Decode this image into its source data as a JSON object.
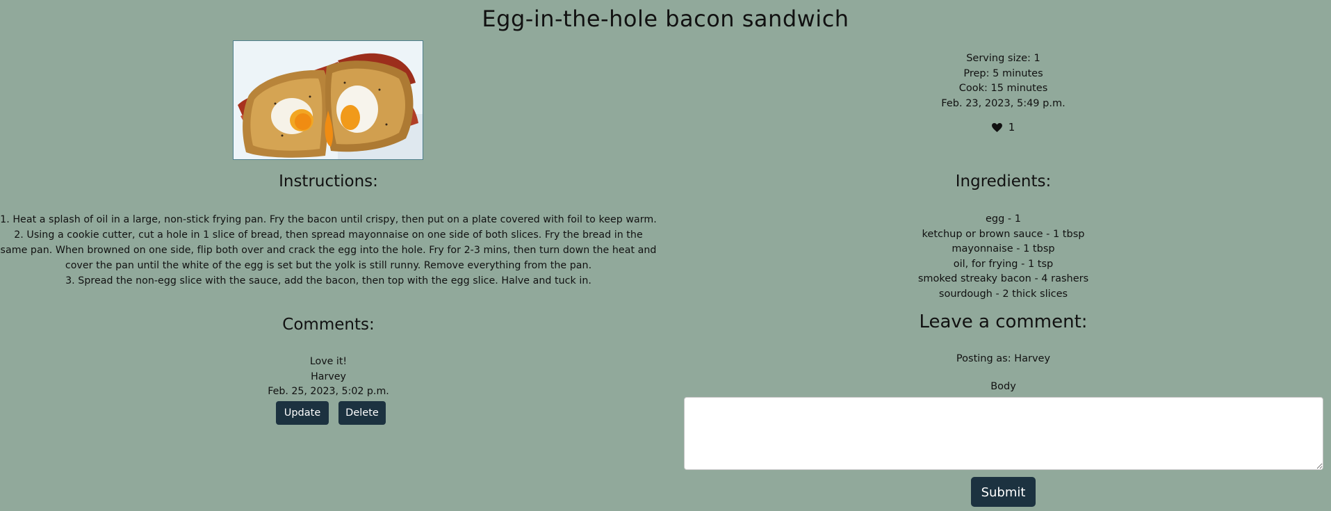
{
  "recipe": {
    "title": "Egg-in-the-hole bacon sandwich",
    "image_alt": "egg-in-the-hole bacon sandwich photo"
  },
  "meta": {
    "serving": "Serving size: 1",
    "prep": "Prep: 5 minutes",
    "cook": "Cook: 15 minutes",
    "date": "Feb. 23, 2023, 5:49 p.m.",
    "likes": "1",
    "like_icon": "heart-icon"
  },
  "instructions": {
    "heading": "Instructions:",
    "steps": [
      "1. Heat a splash of oil in a large, non-stick frying pan. Fry the bacon until crispy, then put on a plate covered with foil to keep warm.",
      "2. Using a cookie cutter, cut a hole in 1 slice of bread, then spread mayonnaise on one side of both slices. Fry the bread in the same pan. When browned on one side, flip both over and crack the egg into the hole. Fry for 2-3 mins, then turn down the heat and cover the pan until the white of the egg is set but the yolk is still runny. Remove everything from the pan.",
      "3. Spread the non-egg slice with the sauce, add the bacon, then top with the egg slice. Halve and tuck in."
    ]
  },
  "ingredients": {
    "heading": "Ingredients:",
    "items": [
      "egg - 1",
      "ketchup or brown sauce - 1 tbsp",
      "mayonnaise - 1 tbsp",
      "oil, for frying - 1 tsp",
      "smoked streaky bacon - 4 rashers",
      "sourdough - 2 thick slices"
    ]
  },
  "comments": {
    "heading": "Comments:",
    "items": [
      {
        "body": "Love it!",
        "author": "Harvey",
        "date": "Feb. 25, 2023, 5:02 p.m.",
        "update_label": "Update",
        "delete_label": "Delete"
      }
    ]
  },
  "comment_form": {
    "heading": "Leave a comment:",
    "posting_as": "Posting as: Harvey",
    "body_label": "Body",
    "body_value": "",
    "submit_label": "Submit"
  },
  "colors": {
    "background": "#91a99b",
    "button": "#1c3240"
  }
}
